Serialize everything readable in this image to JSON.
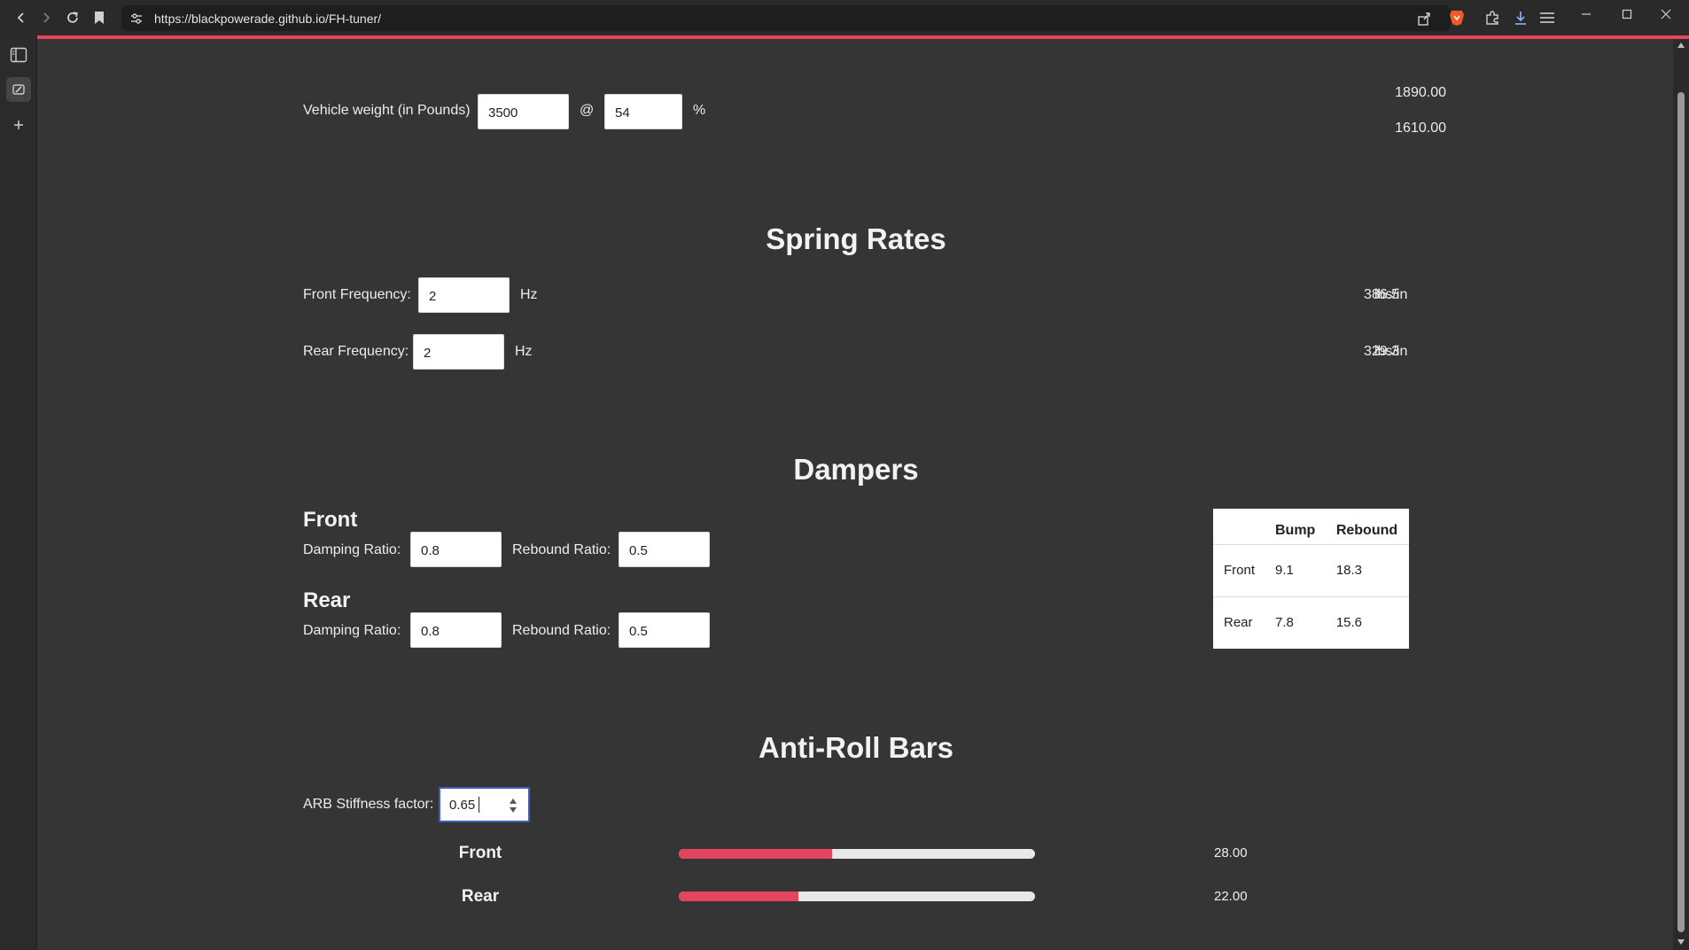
{
  "browser": {
    "url": "https://blackpowerade.github.io/FH-tuner/"
  },
  "weight": {
    "label": "Vehicle weight (in Pounds)",
    "weight_value": "3500",
    "at_symbol": "@",
    "percent_value": "54",
    "percent_symbol": "%",
    "front_weight": "1890.00",
    "rear_weight": "1610.00"
  },
  "springs": {
    "title": "Spring Rates",
    "front_label": "Front Frequency:",
    "front_value": "2",
    "front_unit": "Hz",
    "front_result": "386.5",
    "front_result_unit": "lbs/in",
    "rear_label": "Rear Frequency:",
    "rear_value": "2",
    "rear_unit": "Hz",
    "rear_result": "329.3",
    "rear_result_unit": "lbs/in"
  },
  "dampers": {
    "title": "Dampers",
    "front_title": "Front",
    "rear_title": "Rear",
    "damping_label": "Damping Ratio:",
    "rebound_label": "Rebound Ratio:",
    "front_damping": "0.8",
    "front_rebound": "0.5",
    "rear_damping": "0.8",
    "rear_rebound": "0.5",
    "table": {
      "headers": [
        "",
        "Bump",
        "Rebound"
      ],
      "rows": [
        {
          "name": "Front",
          "bump": "9.1",
          "rebound": "18.3"
        },
        {
          "name": "Rear",
          "bump": "7.8",
          "rebound": "15.6"
        }
      ]
    }
  },
  "arb": {
    "title": "Anti-Roll Bars",
    "stiffness_label": "ARB Stiffness factor:",
    "stiffness_value": "0.65",
    "front_label": "Front",
    "front_value": "28.00",
    "front_level": 0.43,
    "rear_label": "Rear",
    "rear_value": "22.00",
    "rear_level": 0.336
  },
  "colors": {
    "accent": "#e2455d",
    "background": "#353535"
  },
  "icons": {
    "back": "chevron-left-icon",
    "forward": "chevron-right-icon",
    "reload": "reload-icon",
    "bookmark": "bookmark-icon",
    "site_settings": "tune-icon",
    "share": "share-icon",
    "brave": "lion-icon",
    "extensions": "puzzle-icon",
    "downloads": "download-icon",
    "menu": "hamburger-icon",
    "sidebar": "sidebar-icon",
    "leo": "pen-icon",
    "add": "plus-icon"
  }
}
